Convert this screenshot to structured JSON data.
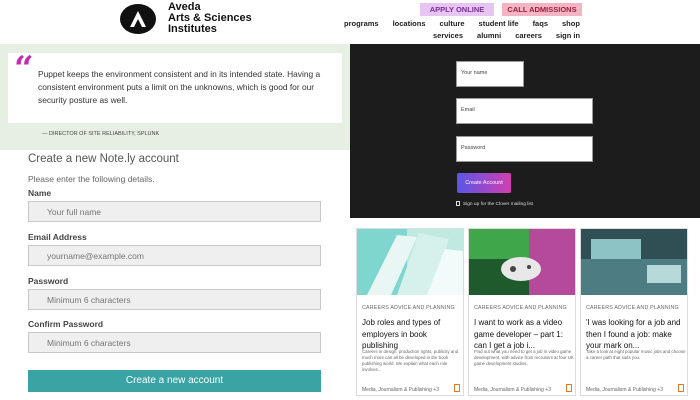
{
  "header": {
    "logo_lines": [
      "Aveda",
      "Arts & Sciences",
      "Institutes"
    ],
    "apply_label": "APPLY ONLINE",
    "call_label": "CALL ADMISSIONS",
    "nav_row1": [
      "programs",
      "locations",
      "culture",
      "student life",
      "faqs",
      "shop"
    ],
    "nav_row2": [
      "services",
      "alumni",
      "careers",
      "sign in"
    ]
  },
  "testimonial": {
    "quote": "Puppet keeps the environment consistent and in its intended state. Having a consistent environment puts a limit on the unknowns, which is good for our security posture as well.",
    "author": "— DIRECTOR OF SITE RELIABILITY, SPLUNK"
  },
  "signup": {
    "title": "Create a new Note.ly account",
    "subtitle": "Please enter the following details.",
    "name_label": "Name",
    "name_placeholder": "Your full name",
    "email_label": "Email Address",
    "email_placeholder": "yourname@example.com",
    "password_label": "Password",
    "password_placeholder": "Minimum 6 characters",
    "confirm_label": "Confirm Password",
    "confirm_placeholder": "Minimum 6 characters",
    "submit_label": "Create a new account"
  },
  "dark_form": {
    "name_placeholder": "Your name",
    "email_placeholder": "Email",
    "password_placeholder": "Password",
    "button_label": "Create Account",
    "checkbox_label": "Sign up for the Clover mailing list"
  },
  "cards": [
    {
      "category": "CAREERS ADVICE AND PLANNING",
      "title": "Job roles and types of employers in book publishing",
      "desc": "Careers in design, production rights, publicity and much more can all be developed in the book publishing world. We explain what each role involves...",
      "footer": "Media, Journalism & Publishing +3"
    },
    {
      "category": "CAREERS ADVICE AND PLANNING",
      "title": "I want to work as a video game developer – part 1: can I get a job i...",
      "desc": "Find out what you need to get a job in video game development, with advice from recruiters at four UK game development studios.",
      "footer": "Media, Journalism & Publishing +3"
    },
    {
      "category": "CAREERS ADVICE AND PLANNING",
      "title": "'I was looking for a job and then I found a job: make your mark on...",
      "desc": "Take a look at eight popular music jobs and choose a career path that suits you.",
      "footer": "Media, Journalism & Publishing +3"
    }
  ],
  "colors": {
    "quote_accent": "#c02db5",
    "submit_teal": "#3aa3a3",
    "dark_panel": "#1c1c1c",
    "bookmark_orange": "#e07a1f"
  }
}
